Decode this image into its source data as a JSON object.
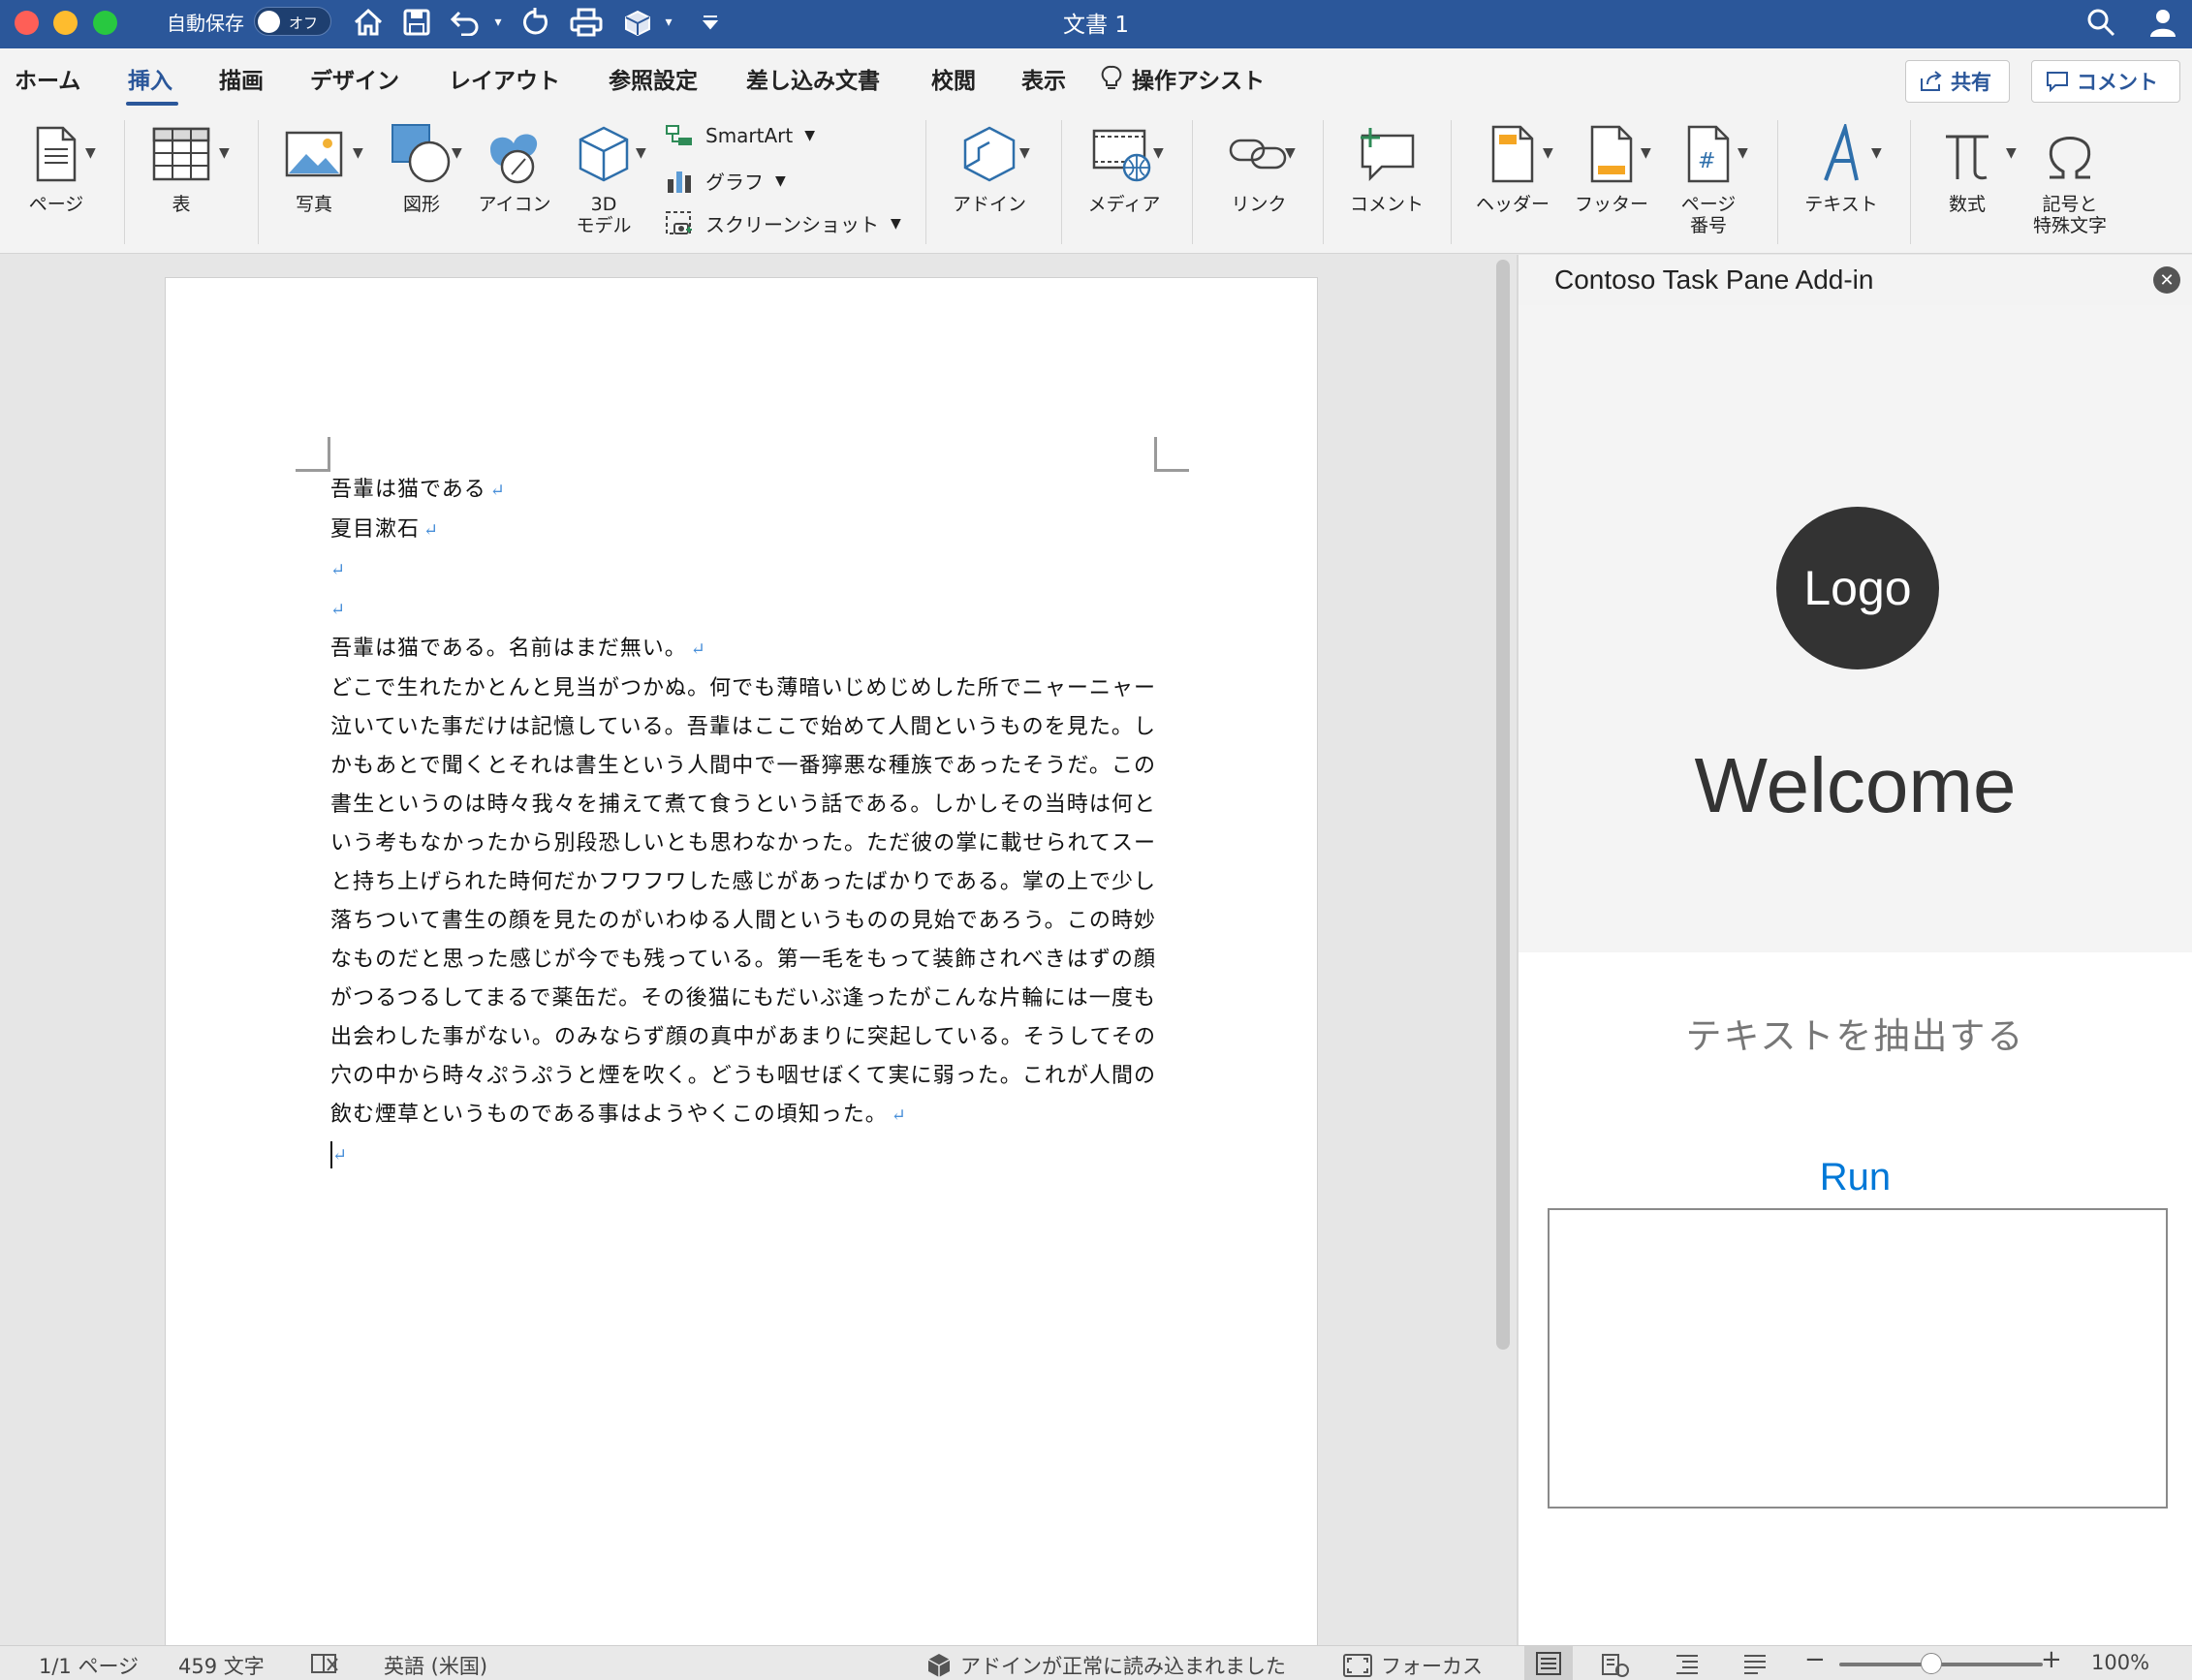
{
  "titlebar": {
    "autosave_label": "自動保存",
    "autosave_state": "オフ",
    "doc_title": "文書 1"
  },
  "tabs": [
    "ホーム",
    "挿入",
    "描画",
    "デザイン",
    "レイアウト",
    "参照設定",
    "差し込み文書",
    "校閲",
    "表示",
    "操作アシスト"
  ],
  "active_tab": "挿入",
  "header_buttons": {
    "share": "共有",
    "comment": "コメント"
  },
  "ribbon": {
    "page": "ページ",
    "table": "表",
    "photo": "写真",
    "shapes": "図形",
    "icons": "アイコン",
    "model3d_line1": "3D",
    "model3d_line2": "モデル",
    "smartart": "SmartArt",
    "graph": "グラフ",
    "screenshot": "スクリーンショット",
    "addin": "アドイン",
    "media": "メディア",
    "link": "リンク",
    "comment": "コメント",
    "header": "ヘッダー",
    "footer": "フッター",
    "page_number_line1": "ページ",
    "page_number_line2": "番号",
    "text": "テキスト",
    "equation": "数式",
    "symbol_line1": "記号と",
    "symbol_line2": "特殊文字"
  },
  "document": {
    "paragraphs": [
      "吾輩は猫である",
      "夏目漱石",
      "",
      "",
      "吾輩は猫である。名前はまだ無い。",
      "どこで生れたかとんと見当がつかぬ。何でも薄暗いじめじめした所でニャーニャー泣いていた事だけは記憶している。吾輩はここで始めて人間というものを見た。しかもあとで聞くとそれは書生という人間中で一番獰悪な種族であったそうだ。この書生というのは時々我々を捕えて煮て食うという話である。しかしその当時は何という考もなかったから別段恐しいとも思わなかった。ただ彼の掌に載せられてスーと持ち上げられた時何だかフワフワした感じがあったばかりである。掌の上で少し落ちついて書生の顔を見たのがいわゆる人間というものの見始であろう。この時妙なものだと思った感じが今でも残っている。第一毛をもって装飾されべきはずの顔がつるつるしてまるで薬缶だ。その後猫にもだいぶ逢ったがこんな片輪には一度も出会わした事がない。のみならず顔の真中があまりに突起している。そうしてその穴の中から時々ぷうぷうと煙を吹く。どうも咽せぼくて実に弱った。これが人間の飲む煙草というものである事はようやくこの頃知った。",
      ""
    ]
  },
  "taskpane": {
    "title": "Contoso Task Pane Add-in",
    "logo": "Logo",
    "welcome": "Welcome",
    "extract_label": "テキストを抽出する",
    "run": "Run",
    "textarea_value": ""
  },
  "statusbar": {
    "page": "1/1 ページ",
    "words": "459 文字",
    "language": "英語 (米国)",
    "addin_status": "アドインが正常に読み込まれました",
    "focus": "フォーカス",
    "zoom": "100%"
  }
}
